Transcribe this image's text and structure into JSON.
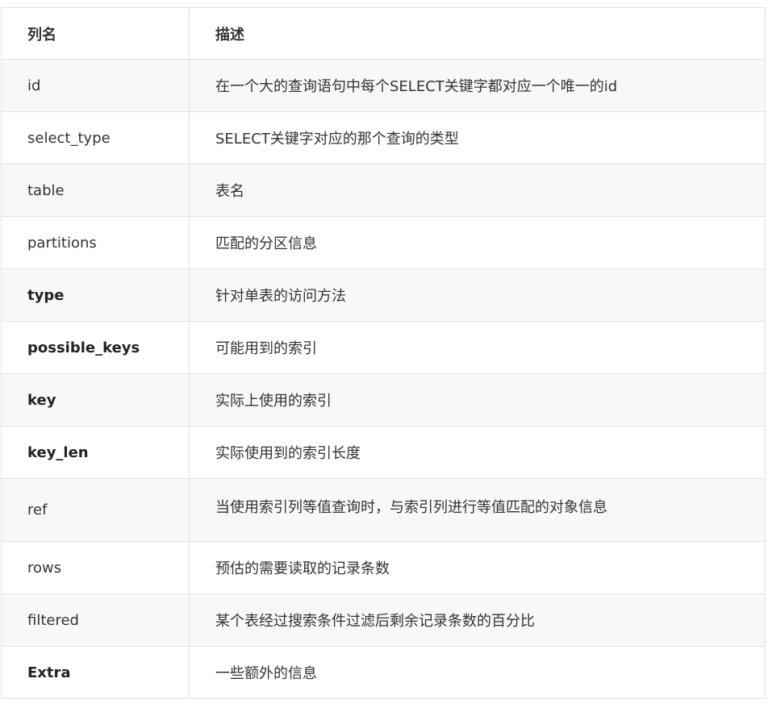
{
  "header": {
    "col1": "列名",
    "col2": "描述"
  },
  "rows": [
    {
      "name": "id",
      "desc": "在一个大的查询语句中每个SELECT关键字都对应一个唯一的id",
      "bold": false
    },
    {
      "name": "select_type",
      "desc": "SELECT关键字对应的那个查询的类型",
      "bold": false
    },
    {
      "name": "table",
      "desc": "表名",
      "bold": false
    },
    {
      "name": "partitions",
      "desc": "匹配的分区信息",
      "bold": false
    },
    {
      "name": "type",
      "desc": "针对单表的访问方法",
      "bold": true
    },
    {
      "name": "possible_keys",
      "desc": "可能用到的索引",
      "bold": true
    },
    {
      "name": "key",
      "desc": "实际上使用的索引",
      "bold": true
    },
    {
      "name": "key_len",
      "desc": "实际使用到的索引长度",
      "bold": true
    },
    {
      "name": "ref",
      "desc": "当使用索引列等值查询时，与索引列进行等值匹配的对象信息",
      "bold": false
    },
    {
      "name": "rows",
      "desc": "预估的需要读取的记录条数",
      "bold": false
    },
    {
      "name": "filtered",
      "desc": "某个表经过搜索条件过滤后剩余记录条数的百分比",
      "bold": false
    },
    {
      "name": "Extra",
      "desc": "一些额外的信息",
      "bold": true
    }
  ]
}
